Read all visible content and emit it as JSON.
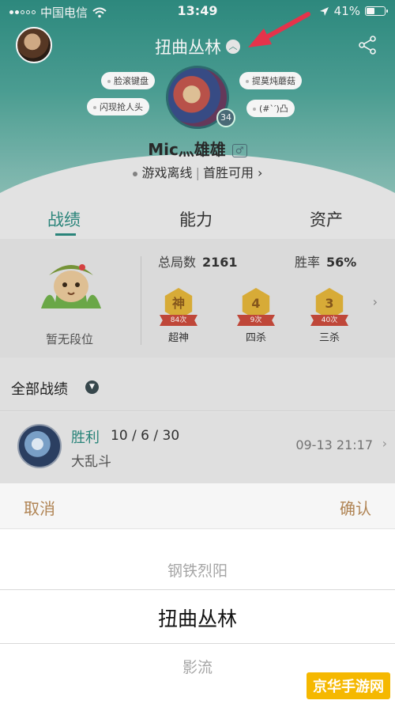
{
  "status_bar": {
    "carrier": "中国电信",
    "time": "13:49",
    "battery": "41%",
    "battery_level": 0.41
  },
  "header": {
    "region_title": "扭曲丛林",
    "tags": [
      "脸滚键盘",
      "提莫炖蘑菇",
      "闪现抢人头",
      "(#`′)凸"
    ],
    "level": "34",
    "summoner_name": "Mic灬雄雄",
    "gender_symbol": "♂",
    "status": "游戏离线",
    "first_win": "首胜可用"
  },
  "tabs": [
    "战绩",
    "能力",
    "资产"
  ],
  "stats": {
    "rank_label": "暂无段位",
    "total_label": "总局数",
    "total_value": "2161",
    "winrate_label": "胜率",
    "winrate_value": "56%",
    "badges": [
      {
        "glyph": "神",
        "count": "84次",
        "name": "超神"
      },
      {
        "glyph": "4",
        "count": "9次",
        "name": "四杀"
      },
      {
        "glyph": "3",
        "count": "40次",
        "name": "三杀"
      }
    ]
  },
  "records": {
    "title": "全部战绩",
    "match": {
      "result": "胜利",
      "kda": "10 / 6 / 30",
      "mode": "大乱斗",
      "time": "09-13 21:17"
    }
  },
  "picker": {
    "cancel": "取消",
    "confirm": "确认",
    "options": [
      "钢铁烈阳",
      "扭曲丛林",
      "影流"
    ]
  },
  "watermark": "京华手游网",
  "colors": {
    "teal": "#2c8a7f",
    "gold": "#b08454",
    "arrow_red": "#e5334b"
  }
}
